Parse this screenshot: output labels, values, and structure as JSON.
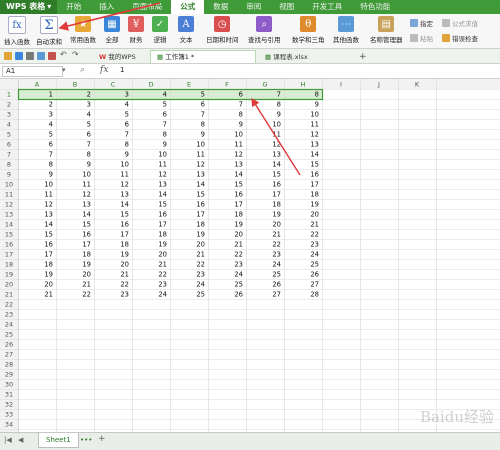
{
  "app": {
    "title": "WPS 表格"
  },
  "menu": [
    "开始",
    "插入",
    "页面布局",
    "公式",
    "数据",
    "审阅",
    "视图",
    "开发工具",
    "特色功能"
  ],
  "menu_active": "公式",
  "ribbon": {
    "insert_function": "插入函数",
    "autosum": "自动求和",
    "common": "常用函数",
    "all": "全部",
    "finance": "财务",
    "logic": "逻辑",
    "text": "文本",
    "datetime": "日期和时间",
    "lookup": "查找与引用",
    "math": "数学和三角",
    "other": "其他函数",
    "name_manager": "名称管理器",
    "specify": "指定",
    "paste": "粘贴",
    "formula_audit": "公式求值",
    "error_check": "错误检查"
  },
  "tabs": [
    "我的WPS",
    "工作簿1 *",
    "课程表.xlsx"
  ],
  "formula_bar": {
    "name_box": "A1",
    "fx": "fx",
    "value": "1"
  },
  "columns": [
    "A",
    "B",
    "C",
    "D",
    "E",
    "F",
    "G",
    "H",
    "I",
    "J",
    "K"
  ],
  "rows": [
    [
      1,
      2,
      3,
      4,
      5,
      6,
      7,
      8
    ],
    [
      2,
      3,
      4,
      5,
      6,
      7,
      8,
      9
    ],
    [
      3,
      4,
      5,
      6,
      7,
      8,
      9,
      10
    ],
    [
      4,
      5,
      6,
      7,
      8,
      9,
      10,
      11
    ],
    [
      5,
      6,
      7,
      8,
      9,
      10,
      11,
      12
    ],
    [
      6,
      7,
      8,
      9,
      10,
      11,
      12,
      13
    ],
    [
      7,
      8,
      9,
      10,
      11,
      12,
      13,
      14
    ],
    [
      8,
      9,
      10,
      11,
      12,
      13,
      14,
      15
    ],
    [
      9,
      10,
      11,
      12,
      13,
      14,
      15,
      16
    ],
    [
      10,
      11,
      12,
      13,
      14,
      15,
      16,
      17
    ],
    [
      11,
      12,
      13,
      14,
      15,
      16,
      17,
      18
    ],
    [
      12,
      13,
      14,
      15,
      16,
      17,
      18,
      19
    ],
    [
      13,
      14,
      15,
      16,
      17,
      18,
      19,
      20
    ],
    [
      14,
      15,
      16,
      17,
      18,
      19,
      20,
      21
    ],
    [
      15,
      16,
      17,
      18,
      19,
      20,
      21,
      22
    ],
    [
      16,
      17,
      18,
      19,
      20,
      21,
      22,
      23
    ],
    [
      17,
      18,
      19,
      20,
      21,
      22,
      23,
      24
    ],
    [
      18,
      19,
      20,
      21,
      22,
      23,
      24,
      25
    ],
    [
      19,
      20,
      21,
      22,
      23,
      24,
      25,
      26
    ],
    [
      20,
      21,
      22,
      23,
      24,
      25,
      26,
      27
    ],
    [
      21,
      22,
      23,
      24,
      25,
      26,
      27,
      28
    ]
  ],
  "total_rows": 34,
  "selected_row": 1,
  "sheet_tab": "Sheet1",
  "watermark": "Baidu经验",
  "colors": {
    "accent": "#3f9b37",
    "selection": "#d7ecd2",
    "arrow": "#e03a3a"
  }
}
